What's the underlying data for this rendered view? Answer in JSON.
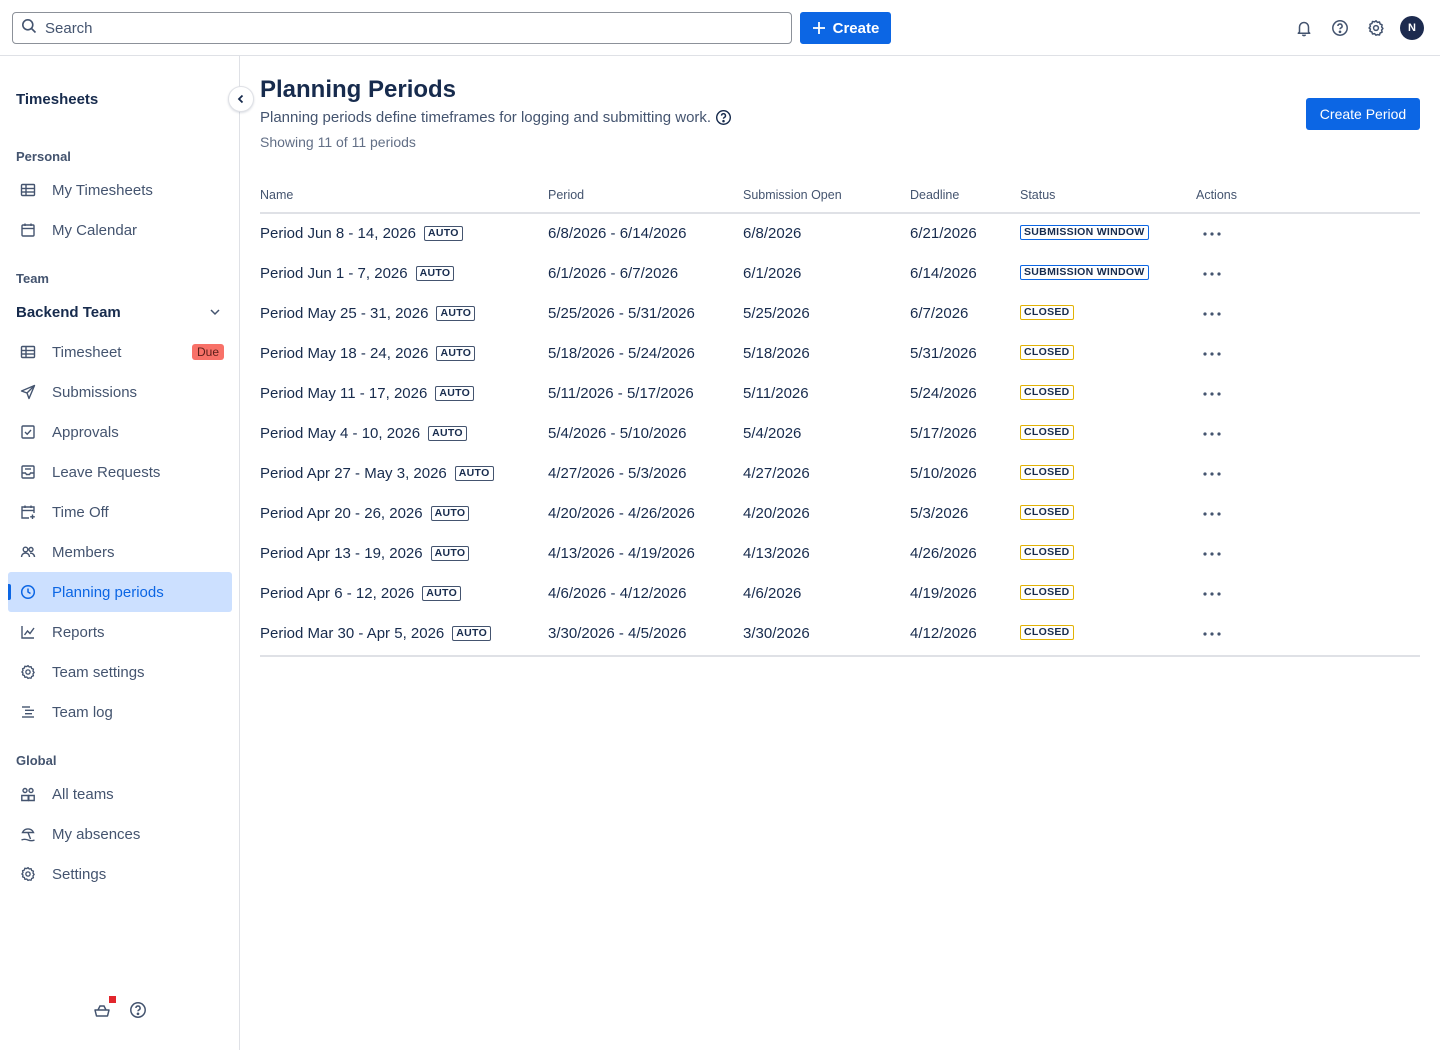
{
  "header": {
    "search_placeholder": "Search",
    "create_label": "Create",
    "avatar_initial": "N",
    "icons": [
      "search-icon",
      "plus-icon",
      "bell-icon",
      "help-icon",
      "gear-icon"
    ]
  },
  "sidebar": {
    "title": "Timesheets",
    "personal_label": "Personal",
    "personal_items": [
      {
        "label": "My Timesheets",
        "icon": "table-icon"
      },
      {
        "label": "My Calendar",
        "icon": "calendar-icon"
      }
    ],
    "team_label": "Team",
    "team_name": "Backend Team",
    "team_items": [
      {
        "label": "Timesheet",
        "icon": "table-icon",
        "badge": "Due"
      },
      {
        "label": "Submissions",
        "icon": "send-icon"
      },
      {
        "label": "Approvals",
        "icon": "checkbox-icon"
      },
      {
        "label": "Leave Requests",
        "icon": "inbox-icon"
      },
      {
        "label": "Time Off",
        "icon": "calendar-plus-icon"
      },
      {
        "label": "Members",
        "icon": "people-icon"
      },
      {
        "label": "Planning periods",
        "icon": "clock-icon",
        "active": true
      },
      {
        "label": "Reports",
        "icon": "chart-icon"
      },
      {
        "label": "Team settings",
        "icon": "gear-icon"
      },
      {
        "label": "Team log",
        "icon": "log-icon"
      }
    ],
    "global_label": "Global",
    "global_items": [
      {
        "label": "All teams",
        "icon": "teams-icon"
      },
      {
        "label": "My absences",
        "icon": "beach-icon"
      },
      {
        "label": "Settings",
        "icon": "gear-icon"
      }
    ]
  },
  "page": {
    "title": "Planning Periods",
    "description": "Planning periods define timeframes for logging and submitting work.",
    "count_text": "Showing 11 of 11 periods",
    "create_button": "Create Period"
  },
  "table": {
    "columns": [
      "Name",
      "Period",
      "Submission Open",
      "Deadline",
      "Status",
      "Actions"
    ],
    "auto_label": "AUTO",
    "rows": [
      {
        "name": "Period Jun 8 - 14, 2026",
        "period": "6/8/2026 - 6/14/2026",
        "open": "6/8/2026",
        "deadline": "6/21/2026",
        "status": "SUBMISSION WINDOW",
        "status_type": "submission"
      },
      {
        "name": "Period Jun 1 - 7, 2026",
        "period": "6/1/2026 - 6/7/2026",
        "open": "6/1/2026",
        "deadline": "6/14/2026",
        "status": "SUBMISSION WINDOW",
        "status_type": "submission"
      },
      {
        "name": "Period May 25 - 31, 2026",
        "period": "5/25/2026 - 5/31/2026",
        "open": "5/25/2026",
        "deadline": "6/7/2026",
        "status": "CLOSED",
        "status_type": "closed"
      },
      {
        "name": "Period May 18 - 24, 2026",
        "period": "5/18/2026 - 5/24/2026",
        "open": "5/18/2026",
        "deadline": "5/31/2026",
        "status": "CLOSED",
        "status_type": "closed"
      },
      {
        "name": "Period May 11 - 17, 2026",
        "period": "5/11/2026 - 5/17/2026",
        "open": "5/11/2026",
        "deadline": "5/24/2026",
        "status": "CLOSED",
        "status_type": "closed"
      },
      {
        "name": "Period May 4 - 10, 2026",
        "period": "5/4/2026 - 5/10/2026",
        "open": "5/4/2026",
        "deadline": "5/17/2026",
        "status": "CLOSED",
        "status_type": "closed"
      },
      {
        "name": "Period Apr 27 - May 3, 2026",
        "period": "4/27/2026 - 5/3/2026",
        "open": "4/27/2026",
        "deadline": "5/10/2026",
        "status": "CLOSED",
        "status_type": "closed"
      },
      {
        "name": "Period Apr 20 - 26, 2026",
        "period": "4/20/2026 - 4/26/2026",
        "open": "4/20/2026",
        "deadline": "5/3/2026",
        "status": "CLOSED",
        "status_type": "closed"
      },
      {
        "name": "Period Apr 13 - 19, 2026",
        "period": "4/13/2026 - 4/19/2026",
        "open": "4/13/2026",
        "deadline": "4/26/2026",
        "status": "CLOSED",
        "status_type": "closed"
      },
      {
        "name": "Period Apr 6 - 12, 2026",
        "period": "4/6/2026 - 4/12/2026",
        "open": "4/6/2026",
        "deadline": "4/19/2026",
        "status": "CLOSED",
        "status_type": "closed"
      },
      {
        "name": "Period Mar 30 - Apr 5, 2026",
        "period": "3/30/2026 - 4/5/2026",
        "open": "3/30/2026",
        "deadline": "4/12/2026",
        "status": "CLOSED",
        "status_type": "closed"
      }
    ]
  },
  "colors": {
    "primary": "#0c66e4",
    "active_bg": "#cce0ff",
    "due_badge": "#f87168",
    "closed_border": "#e2b203",
    "notification_dot": "#e2262c"
  }
}
